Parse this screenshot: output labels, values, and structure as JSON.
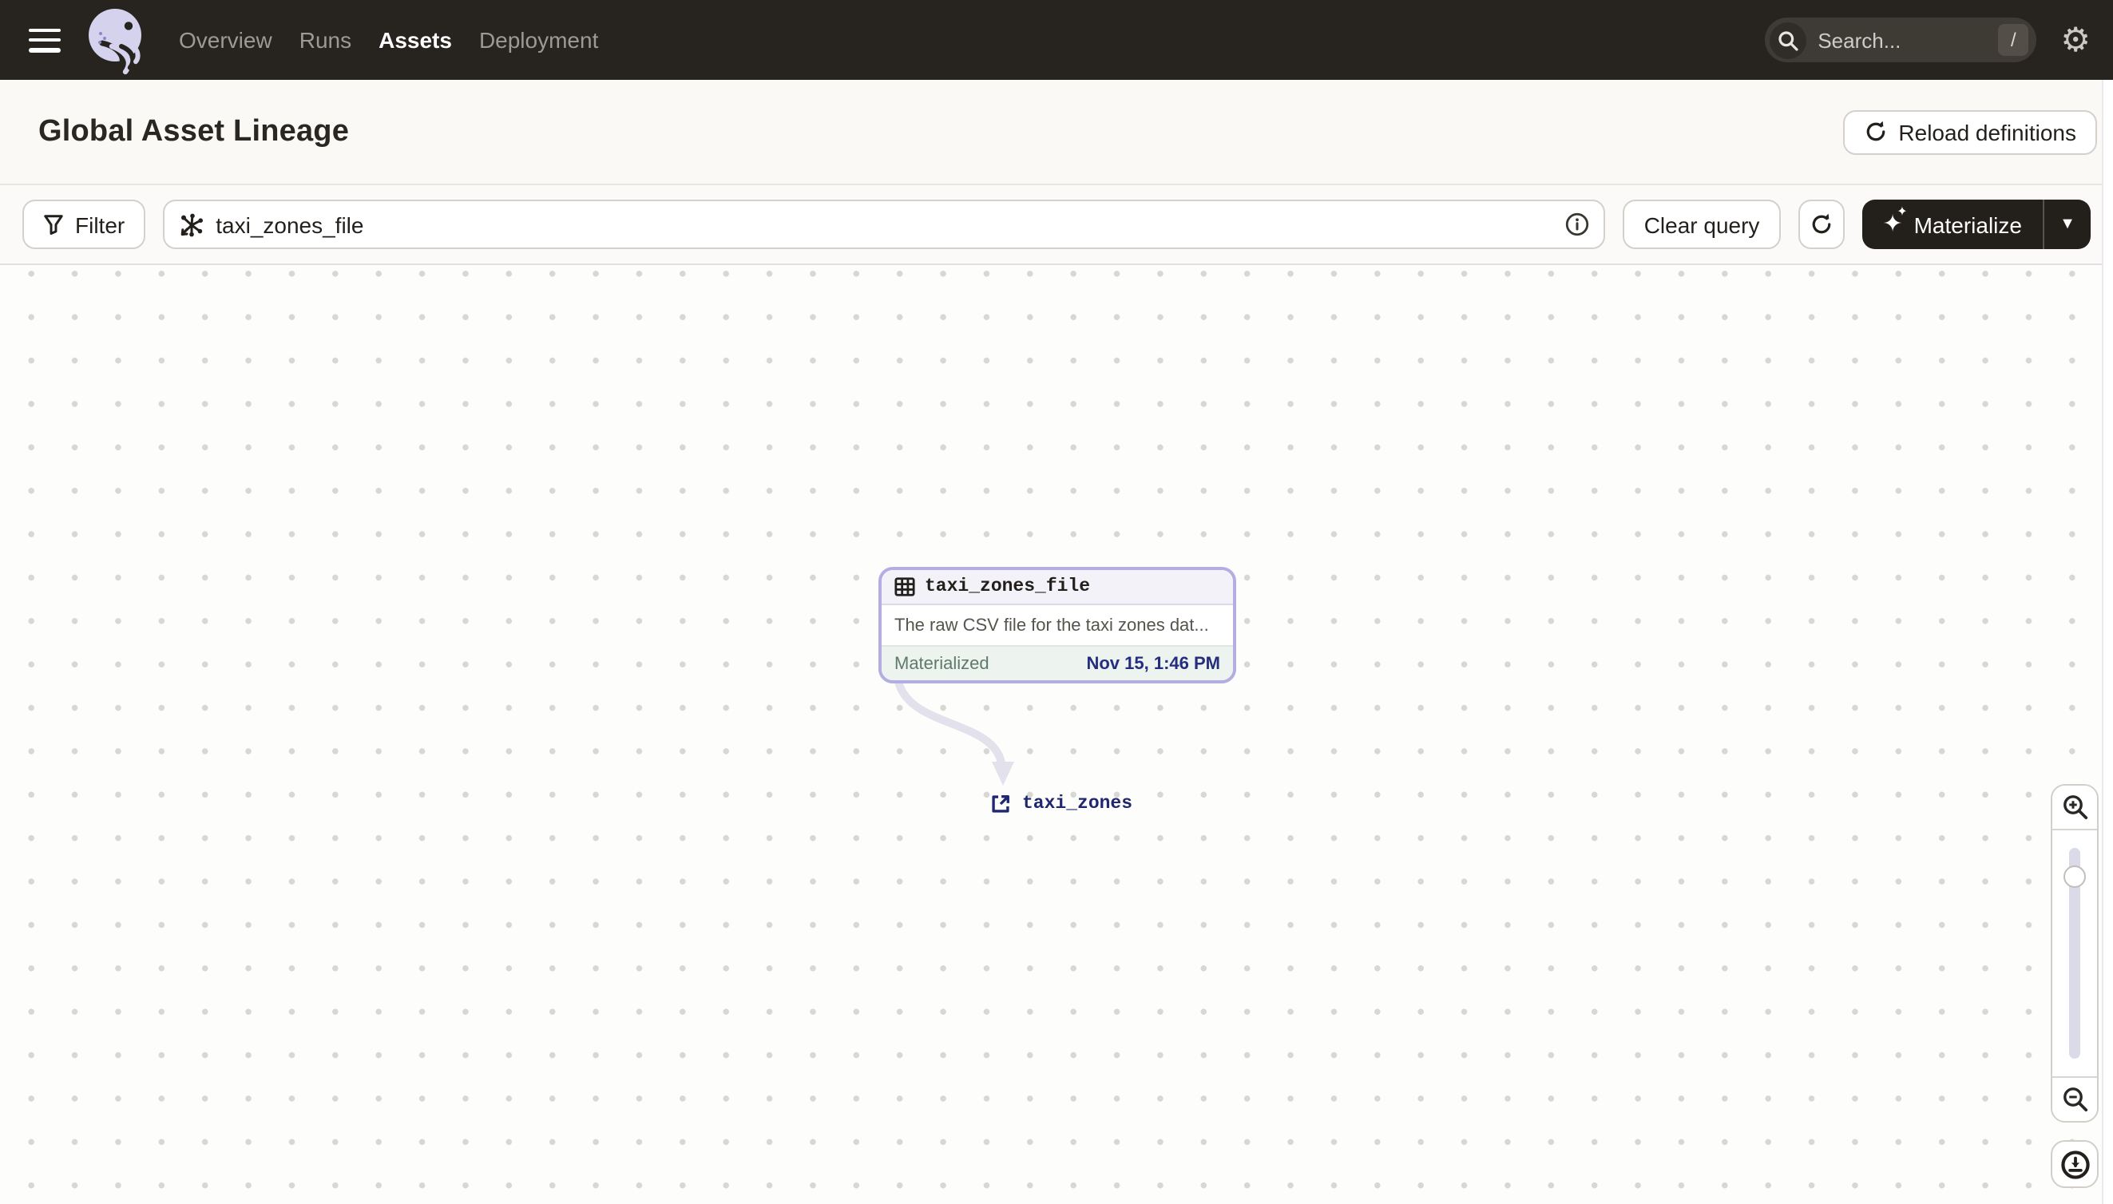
{
  "nav": {
    "items": [
      {
        "label": "Overview",
        "active": false
      },
      {
        "label": "Runs",
        "active": false
      },
      {
        "label": "Assets",
        "active": true
      },
      {
        "label": "Deployment",
        "active": false
      }
    ],
    "search": {
      "placeholder": "Search...",
      "shortcut": "/"
    }
  },
  "header": {
    "title": "Global Asset Lineage",
    "reload_label": "Reload definitions"
  },
  "toolbar": {
    "filter_label": "Filter",
    "query_value": "taxi_zones_file",
    "clear_label": "Clear query",
    "materialize_label": "Materialize"
  },
  "graph": {
    "node": {
      "name": "taxi_zones_file",
      "description": "The raw CSV file for the taxi zones dat...",
      "status_label": "Materialized",
      "status_time": "Nov 15, 1:46 PM"
    },
    "downstream": {
      "name": "taxi_zones"
    }
  },
  "icons": {
    "gear": "⚙",
    "sparkle": "✦",
    "sparkle_small": "✧",
    "caret_down": "▼"
  },
  "colors": {
    "nav_bg": "#27231E",
    "accent_lavender": "#B3ADE1",
    "node_header_bg": "#F3F2F9",
    "node_footer_bg": "#EDF3EE",
    "status_green": "#5F7A6B",
    "timestamp_navy": "#252D7F",
    "link_navy": "#20266F",
    "dark": "#231F1B",
    "edge_gray": "#E2E1EC"
  }
}
